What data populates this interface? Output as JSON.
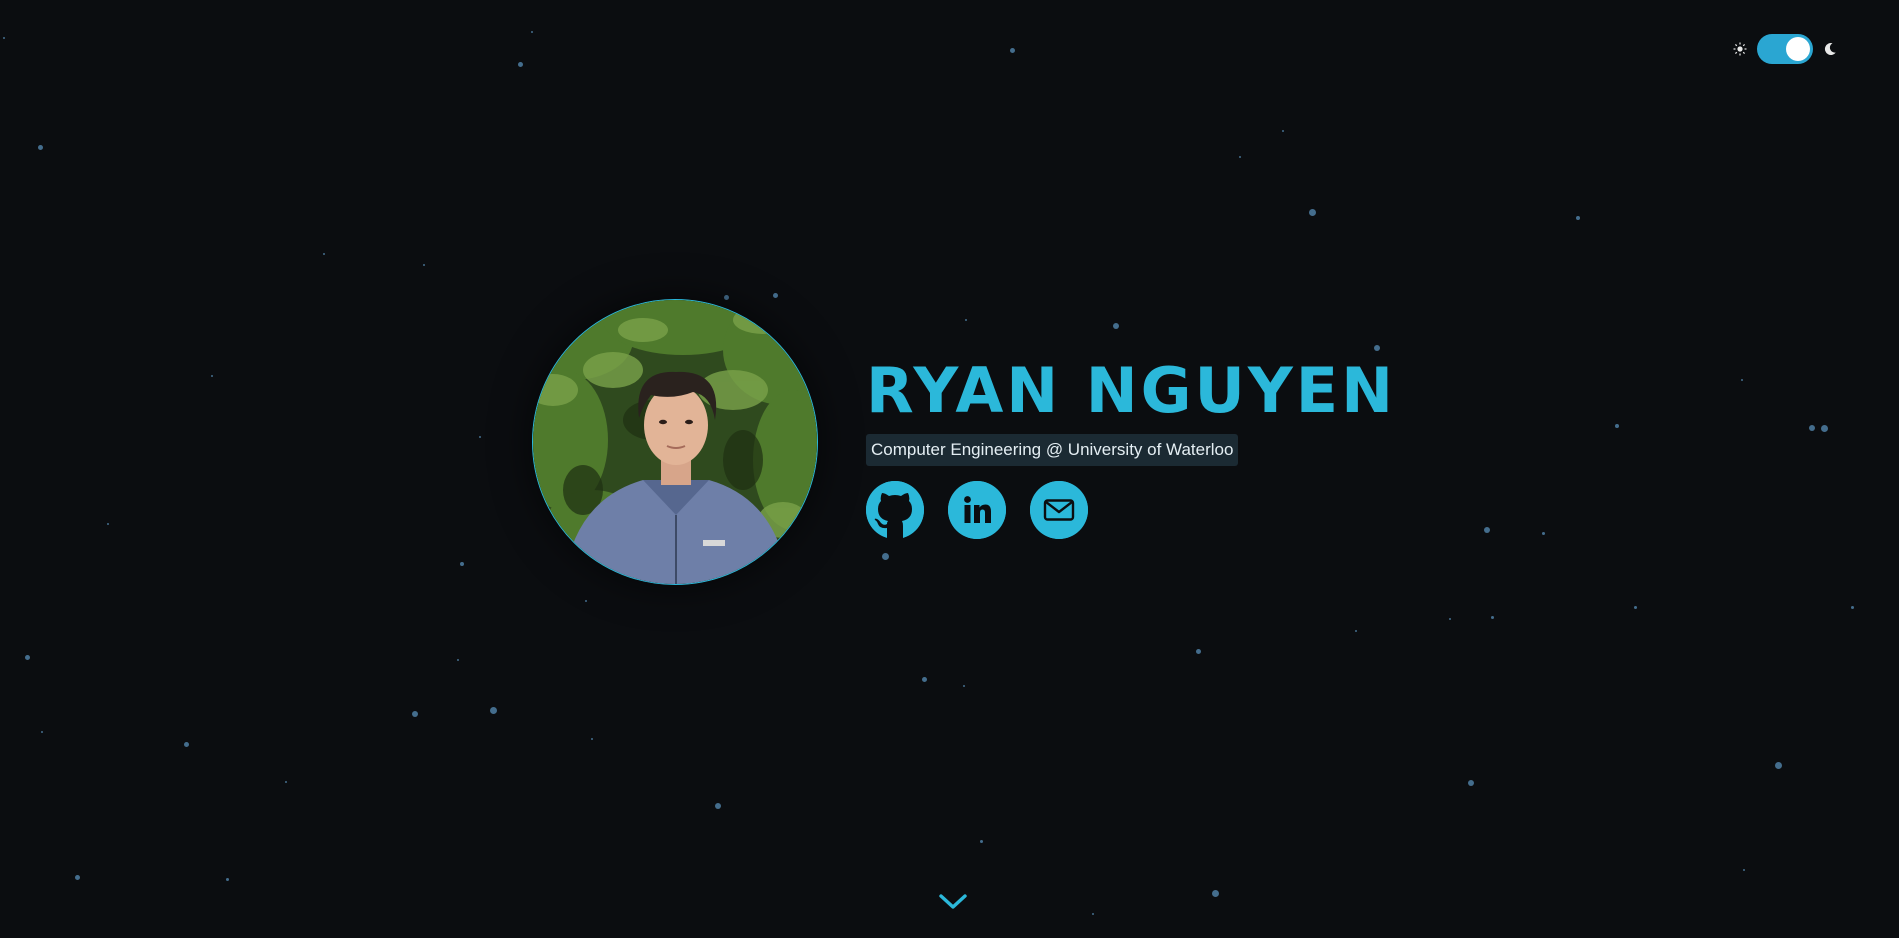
{
  "profile": {
    "name": "RYAN NGUYEN",
    "subtitle": "Computer Engineering @ University of Waterloo",
    "photo_alt": "Ryan Nguyen"
  },
  "socials": [
    {
      "name": "github",
      "icon": "github-icon"
    },
    {
      "name": "linkedin",
      "icon": "linkedin-icon"
    },
    {
      "name": "email",
      "icon": "mail-icon"
    }
  ],
  "theme": {
    "mode": "dark",
    "toggle_on": true,
    "accent": "#2bb8da",
    "background": "#0b0d10"
  },
  "scroll_indicator": {
    "icon": "chevron-down-icon"
  }
}
